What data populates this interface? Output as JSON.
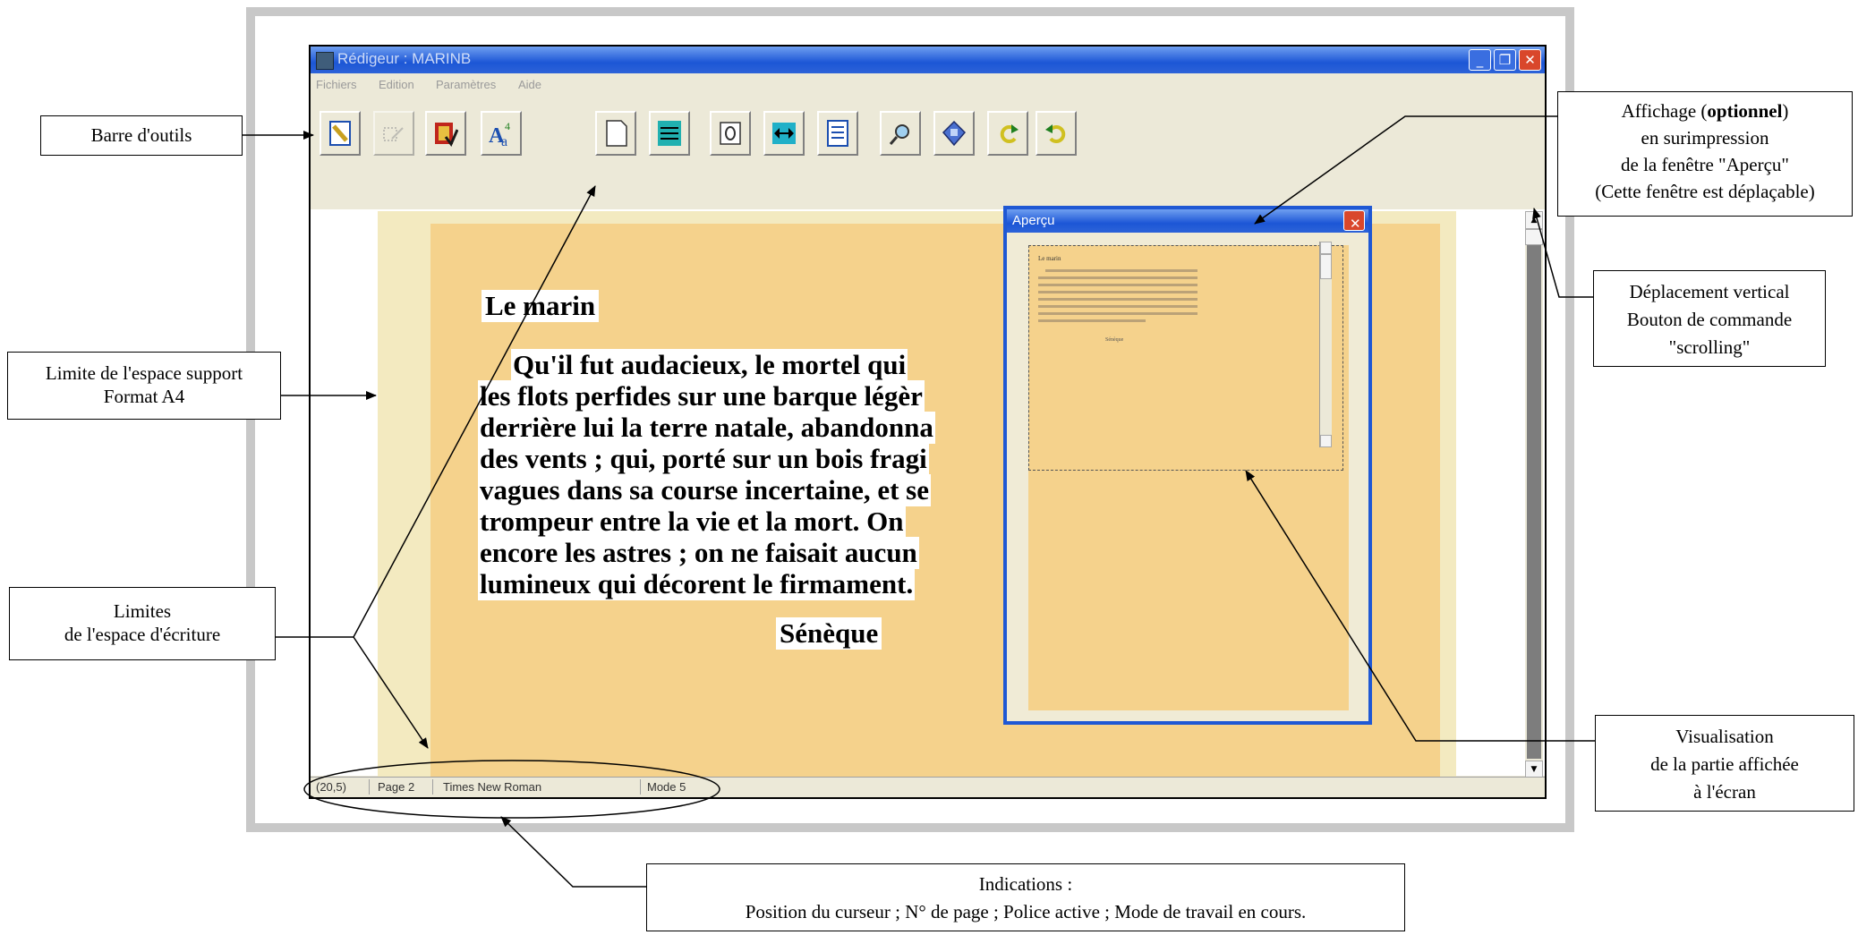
{
  "window": {
    "title": "Rédigeur : MARINB",
    "minimize_icon": "minimize-icon",
    "maximize_icon": "restore-icon",
    "close_icon": "close-icon",
    "colors": {
      "titlebar": "#1c56d6",
      "page_background": "#f3eac0",
      "writing_area": "#f5d28c",
      "close_button": "#d9472b"
    }
  },
  "menu": [
    "Fichiers",
    "Edition",
    "Paramètres",
    "Aide"
  ],
  "toolbar": {
    "buttons": [
      {
        "name": "pencil-icon"
      },
      {
        "name": "disabled-tool-icon"
      },
      {
        "name": "dictionary-icon"
      },
      {
        "name": "font-icon"
      },
      {
        "name": "new-page-icon"
      },
      {
        "name": "spacing-icon"
      },
      {
        "name": "hand-icon"
      },
      {
        "name": "width-icon"
      },
      {
        "name": "document-icon"
      },
      {
        "name": "magnifier-icon"
      },
      {
        "name": "diskette-icon"
      },
      {
        "name": "undo-icon"
      },
      {
        "name": "redo-icon"
      }
    ]
  },
  "document": {
    "title": "Le marin",
    "lines": [
      "Qu'il fut audacieux, le  mortel  qui",
      "les flots perfides sur une barque  légèr",
      "derrière lui la terre natale, abandonna",
      "des vents ; qui, porté sur un bois  fragi",
      "vagues dans sa course incertaine, et se",
      "trompeur entre la vie et la  mort.  On",
      "encore les astres ; on ne faisait aucun",
      "lumineux qui décorent le firmament."
    ],
    "author": "Sénèque"
  },
  "preview": {
    "title": "Aperçu",
    "mini_title": "Le marin",
    "mini_author": "Sénèque"
  },
  "status": {
    "cursor": "(20,5)",
    "page": "Page 2",
    "font": "Times New Roman",
    "mode": "Mode 5"
  },
  "callouts": {
    "toolbar": "Barre d'outils",
    "support": [
      "Limite de l'espace support",
      "Format A4"
    ],
    "writing": [
      "Limites",
      "de l'espace d'écriture"
    ],
    "preview_window_pre": "Affichage (",
    "preview_window_bold": "optionnel",
    "preview_window_post": ")",
    "preview_window_lines": [
      "en surimpression",
      "de la fenêtre \"Aperçu\"",
      "(Cette fenêtre est déplaçable)"
    ],
    "scroll": [
      "Déplacement vertical",
      "Bouton de commande",
      "\"scrolling\""
    ],
    "visualisation": [
      "Visualisation",
      "de la partie affichée",
      "à l'écran"
    ],
    "indications": [
      "Indications :",
      "Position du curseur ; N° de page ; Police active ; Mode de travail en cours."
    ]
  }
}
